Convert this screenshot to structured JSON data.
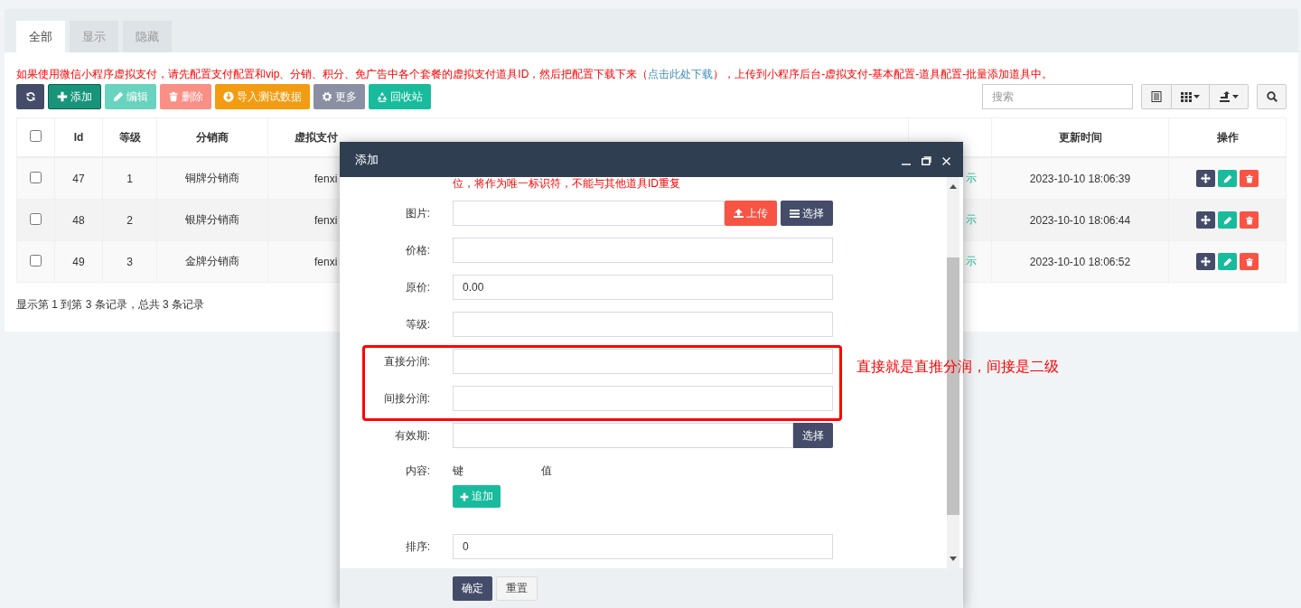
{
  "tabs": [
    {
      "label": "全部",
      "selected": true
    },
    {
      "label": "显示",
      "selected": false
    },
    {
      "label": "隐藏",
      "selected": false
    }
  ],
  "notice": {
    "text_before": "如果使用微信小程序虚拟支付，请先配置支付配置和vip、分销、积分、免广告中各个套餐的虚拟支付道具ID，然后把配置下载下来（",
    "link": "点击此处下载",
    "text_after": "），上传到小程序后台-虚拟支付-基本配置-道具配置-批量添加道具中。"
  },
  "toolbar": {
    "buttons": [
      {
        "kind": "refresh",
        "disabled": false
      },
      {
        "kind": "add",
        "label": "添加",
        "disabled": false
      },
      {
        "kind": "edit",
        "label": "编辑",
        "disabled": true
      },
      {
        "kind": "delete",
        "label": "删除",
        "disabled": true
      },
      {
        "kind": "import",
        "label": "导入测试数据",
        "disabled": false
      },
      {
        "kind": "more",
        "label": "更多",
        "disabled": false
      },
      {
        "kind": "recycle",
        "label": "回收站",
        "disabled": false
      }
    ],
    "search": {
      "placeholder": "搜索"
    }
  },
  "table": {
    "header_checked": false,
    "columns": [
      {
        "kind": "checkbox"
      },
      {
        "kind": "text",
        "label": "Id"
      },
      {
        "kind": "text",
        "label": "等级"
      },
      {
        "kind": "text",
        "label": "分销商"
      },
      {
        "kind": "cut",
        "label": "虚拟支付"
      },
      {
        "kind": "status"
      },
      {
        "kind": "text",
        "label": "更新时间"
      },
      {
        "kind": "actions",
        "label": "操作"
      }
    ],
    "rows": [
      {
        "checked": false,
        "id": "47",
        "level": "1",
        "name": "铜牌分销商",
        "column_5": "fenxi",
        "column_6": "示",
        "updated": "2023-10-10 18:06:39"
      },
      {
        "checked": false,
        "id": "48",
        "level": "2",
        "name": "银牌分销商",
        "column_5": "fenxi",
        "column_6": "示",
        "updated": "2023-10-10 18:06:44"
      },
      {
        "checked": false,
        "id": "49",
        "level": "3",
        "name": "金牌分销商",
        "column_5": "fenxi",
        "column_6": "示",
        "updated": "2023-10-10 18:06:52"
      }
    ]
  },
  "pagination": "显示第 1 到第 3 条记录，总共 3 条记录",
  "dialog": {
    "title": "添加",
    "notice": "位，将作为唯一标识符，不能与其他道具ID重复",
    "fields": [
      {
        "kind": "upload",
        "label": "图片:",
        "buttons": [
          "上传",
          "选择"
        ]
      },
      {
        "kind": "text",
        "label": "价格:"
      },
      {
        "kind": "text",
        "label": "原价:",
        "value": "0.00"
      },
      {
        "kind": "text",
        "label": "等级:"
      },
      {
        "kind": "text",
        "label": "直接分润:"
      },
      {
        "kind": "text",
        "label": "间接分润:"
      },
      {
        "kind": "picker",
        "label": "有效期:",
        "button": "选择"
      },
      {
        "kind": "keyvalue",
        "label": "内容:",
        "key_header": "键",
        "value_header": "值",
        "button": "追加"
      },
      {
        "kind": "text",
        "label": "排序:",
        "value": "0"
      }
    ],
    "buttons": [
      {
        "kind": "primary",
        "label": "确定"
      },
      {
        "kind": "default",
        "label": "重置"
      }
    ]
  },
  "annotation": {
    "text": "直接就是直推分润，间接是二级"
  }
}
